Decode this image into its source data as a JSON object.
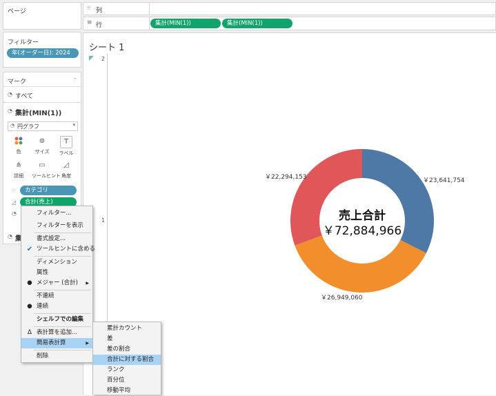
{
  "pages": {
    "title": "ページ"
  },
  "shelves": {
    "columns_label": "列",
    "rows_label": "行",
    "rows_pills": [
      "集計(MIN(1))",
      "集計(MIN(1))"
    ]
  },
  "filters": {
    "title": "フィルター",
    "pill": "年(オーダー日): 2024"
  },
  "marks": {
    "title": "マーク",
    "all": "すべて",
    "measure": "集計(MIN(1))",
    "mark_type": "円グラフ",
    "cards": [
      {
        "label": "色",
        "icon": "color-dots-icon"
      },
      {
        "label": "サイズ",
        "icon": "size-icon"
      },
      {
        "label": "ラベル",
        "icon": "label-icon"
      },
      {
        "label": "詳細",
        "icon": "detail-icon"
      },
      {
        "label": "ツールヒント",
        "icon": "tooltip-icon"
      },
      {
        "label": "角度",
        "icon": "angle-icon"
      }
    ],
    "fields": [
      "カテゴリ",
      "合計(売上)"
    ],
    "collapsed_label": "集"
  },
  "sheet": {
    "title": "シート 1",
    "axis_top": "2",
    "axis_mid": "1"
  },
  "chart_data": {
    "type": "pie",
    "style": "donut",
    "center_title": "売上合計",
    "center_value": "￥72,884,966",
    "slices": [
      {
        "label": "￥23,641,754",
        "value": 23641754,
        "color": "#4e79a7"
      },
      {
        "label": "￥26,949,060",
        "value": 26949060,
        "color": "#f28e2b"
      },
      {
        "label": "￥22,294,153",
        "value": 22294153,
        "color": "#e15759"
      }
    ]
  },
  "context_menu": {
    "items": [
      {
        "label": "フィルター..."
      },
      {
        "label": "フィルターを表示"
      },
      {
        "label": "書式設定..."
      },
      {
        "label": "ツールヒントに含める",
        "mark": "check"
      },
      {
        "label": "ディメンション"
      },
      {
        "label": "属性"
      },
      {
        "label": "メジャー (合計)",
        "mark": "dot",
        "submenu": true
      },
      {
        "label": "不連続"
      },
      {
        "label": "連続",
        "mark": "dot"
      },
      {
        "label": "シェルフでの編集"
      },
      {
        "label": "表計算を追加...",
        "mark": "delta"
      },
      {
        "label": "簡易表計算",
        "submenu": true,
        "highlight": true
      },
      {
        "label": "削除"
      }
    ]
  },
  "submenu": {
    "items": [
      {
        "label": "累計カウント"
      },
      {
        "label": "差"
      },
      {
        "label": "差の割合"
      },
      {
        "label": "合計に対する割合",
        "highlight": true
      },
      {
        "label": "ランク"
      },
      {
        "label": "百分位"
      },
      {
        "label": "移動平均"
      }
    ]
  }
}
